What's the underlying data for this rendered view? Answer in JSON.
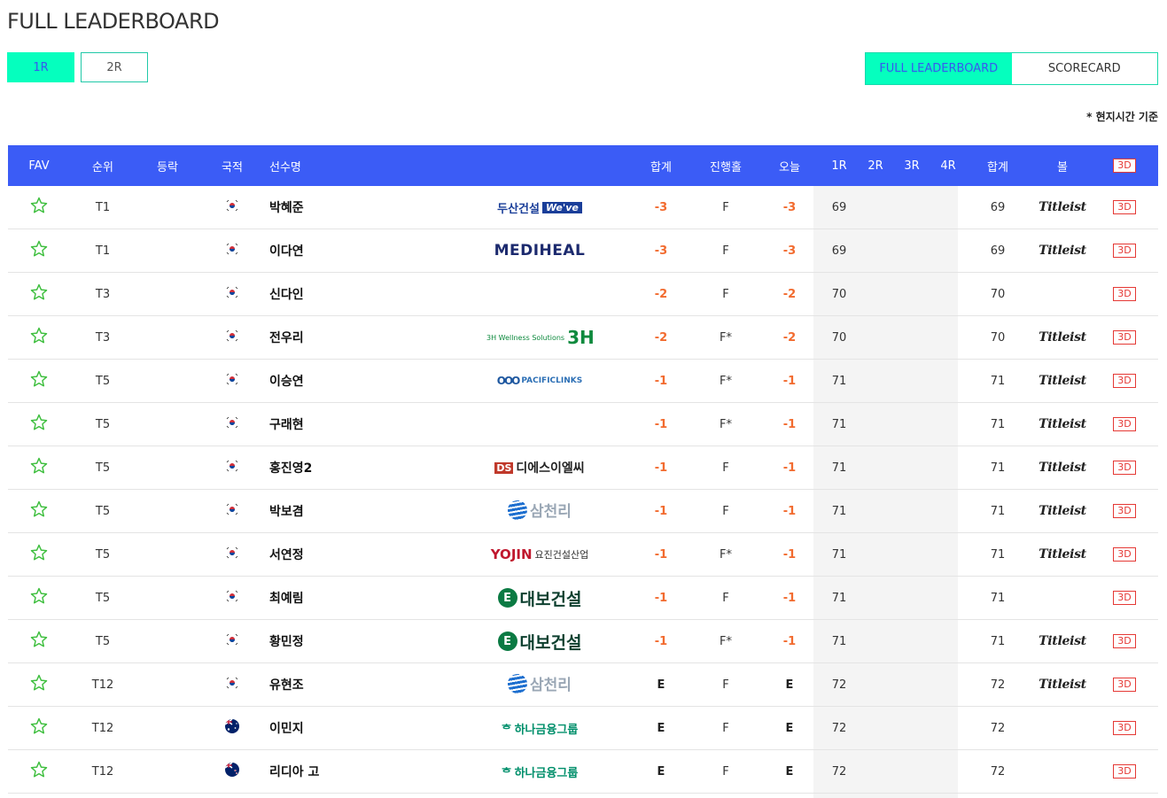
{
  "page_title": "FULL LEADERBOARD",
  "round_tabs": [
    "1R",
    "2R"
  ],
  "view_tabs": [
    "FULL LEADERBOARD",
    "SCORECARD"
  ],
  "time_note": "* 현지시간 기준",
  "headers": {
    "fav": "FAV",
    "rank": "순위",
    "move": "등락",
    "nation": "국적",
    "name": "선수명",
    "total": "합계",
    "hole": "진행홀",
    "today": "오늘",
    "r1": "1R",
    "r2": "2R",
    "r3": "3R",
    "r4": "4R",
    "sum": "합계",
    "ball": "볼",
    "three_d": "3D"
  },
  "colors": {
    "accent": "#05ffbe",
    "header_bg": "#3b5cf6",
    "under_par": "#f26b2f",
    "three_d": "#e53935"
  },
  "rows": [
    {
      "rank": "T1",
      "flag": "KOR",
      "name": "박혜준",
      "sponsor": "doosan",
      "total": "-3",
      "hole": "F",
      "today": "-3",
      "r1": "69",
      "sum": "69",
      "ball": "Titleist",
      "three_d": "3D"
    },
    {
      "rank": "T1",
      "flag": "KOR",
      "name": "이다연",
      "sponsor": "mediheal",
      "total": "-3",
      "hole": "F",
      "today": "-3",
      "r1": "69",
      "sum": "69",
      "ball": "Titleist",
      "three_d": "3D"
    },
    {
      "rank": "T3",
      "flag": "KOR",
      "name": "신다인",
      "sponsor": "",
      "total": "-2",
      "hole": "F",
      "today": "-2",
      "r1": "70",
      "sum": "70",
      "ball": "",
      "three_d": "3D"
    },
    {
      "rank": "T3",
      "flag": "KOR",
      "name": "전우리",
      "sponsor": "3h",
      "total": "-2",
      "hole": "F*",
      "today": "-2",
      "r1": "70",
      "sum": "70",
      "ball": "Titleist",
      "three_d": "3D"
    },
    {
      "rank": "T5",
      "flag": "KOR",
      "name": "이승연",
      "sponsor": "pacific",
      "total": "-1",
      "hole": "F*",
      "today": "-1",
      "r1": "71",
      "sum": "71",
      "ball": "Titleist",
      "three_d": "3D"
    },
    {
      "rank": "T5",
      "flag": "KOR",
      "name": "구래현",
      "sponsor": "",
      "total": "-1",
      "hole": "F*",
      "today": "-1",
      "r1": "71",
      "sum": "71",
      "ball": "Titleist",
      "three_d": "3D"
    },
    {
      "rank": "T5",
      "flag": "KOR",
      "name": "홍진영2",
      "sponsor": "ds",
      "total": "-1",
      "hole": "F",
      "today": "-1",
      "r1": "71",
      "sum": "71",
      "ball": "Titleist",
      "three_d": "3D"
    },
    {
      "rank": "T5",
      "flag": "KOR",
      "name": "박보겸",
      "sponsor": "samchully",
      "total": "-1",
      "hole": "F",
      "today": "-1",
      "r1": "71",
      "sum": "71",
      "ball": "Titleist",
      "three_d": "3D"
    },
    {
      "rank": "T5",
      "flag": "KOR",
      "name": "서연정",
      "sponsor": "yojin",
      "total": "-1",
      "hole": "F*",
      "today": "-1",
      "r1": "71",
      "sum": "71",
      "ball": "Titleist",
      "three_d": "3D"
    },
    {
      "rank": "T5",
      "flag": "KOR",
      "name": "최예림",
      "sponsor": "daebo",
      "total": "-1",
      "hole": "F",
      "today": "-1",
      "r1": "71",
      "sum": "71",
      "ball": "",
      "three_d": "3D"
    },
    {
      "rank": "T5",
      "flag": "KOR",
      "name": "황민정",
      "sponsor": "daebo",
      "total": "-1",
      "hole": "F*",
      "today": "-1",
      "r1": "71",
      "sum": "71",
      "ball": "Titleist",
      "three_d": "3D"
    },
    {
      "rank": "T12",
      "flag": "KOR",
      "name": "유현조",
      "sponsor": "samchully",
      "total": "E",
      "hole": "F",
      "today": "E",
      "r1": "72",
      "sum": "72",
      "ball": "Titleist",
      "three_d": "3D"
    },
    {
      "rank": "T12",
      "flag": "AUS",
      "name": "이민지",
      "sponsor": "hana",
      "total": "E",
      "hole": "F",
      "today": "E",
      "r1": "72",
      "sum": "72",
      "ball": "",
      "three_d": "3D"
    },
    {
      "rank": "T12",
      "flag": "NZL",
      "name": "리디아 고",
      "sponsor": "hana",
      "total": "E",
      "hole": "F",
      "today": "E",
      "r1": "72",
      "sum": "72",
      "ball": "",
      "three_d": "3D"
    }
  ],
  "sponsor_logos": {
    "doosan": {
      "text": "두산건설",
      "badge": "We've"
    },
    "mediheal": {
      "text": "MEDIHEAL"
    },
    "3h": {
      "text": "3H Wellness Solutions",
      "badge": "3H"
    },
    "pacific": {
      "text": "PACIFICLINKS",
      "badge": "OOO"
    },
    "ds": {
      "text": "디에스이엘씨",
      "badge": "DS"
    },
    "samchully": {
      "text": "삼천리"
    },
    "yojin": {
      "text": "YOJIN",
      "sub": "요진건설산업"
    },
    "daebo": {
      "text": "대보건설",
      "badge": "E"
    },
    "hana": {
      "text": "하나금융그룹",
      "badge": "ᄒ"
    }
  }
}
